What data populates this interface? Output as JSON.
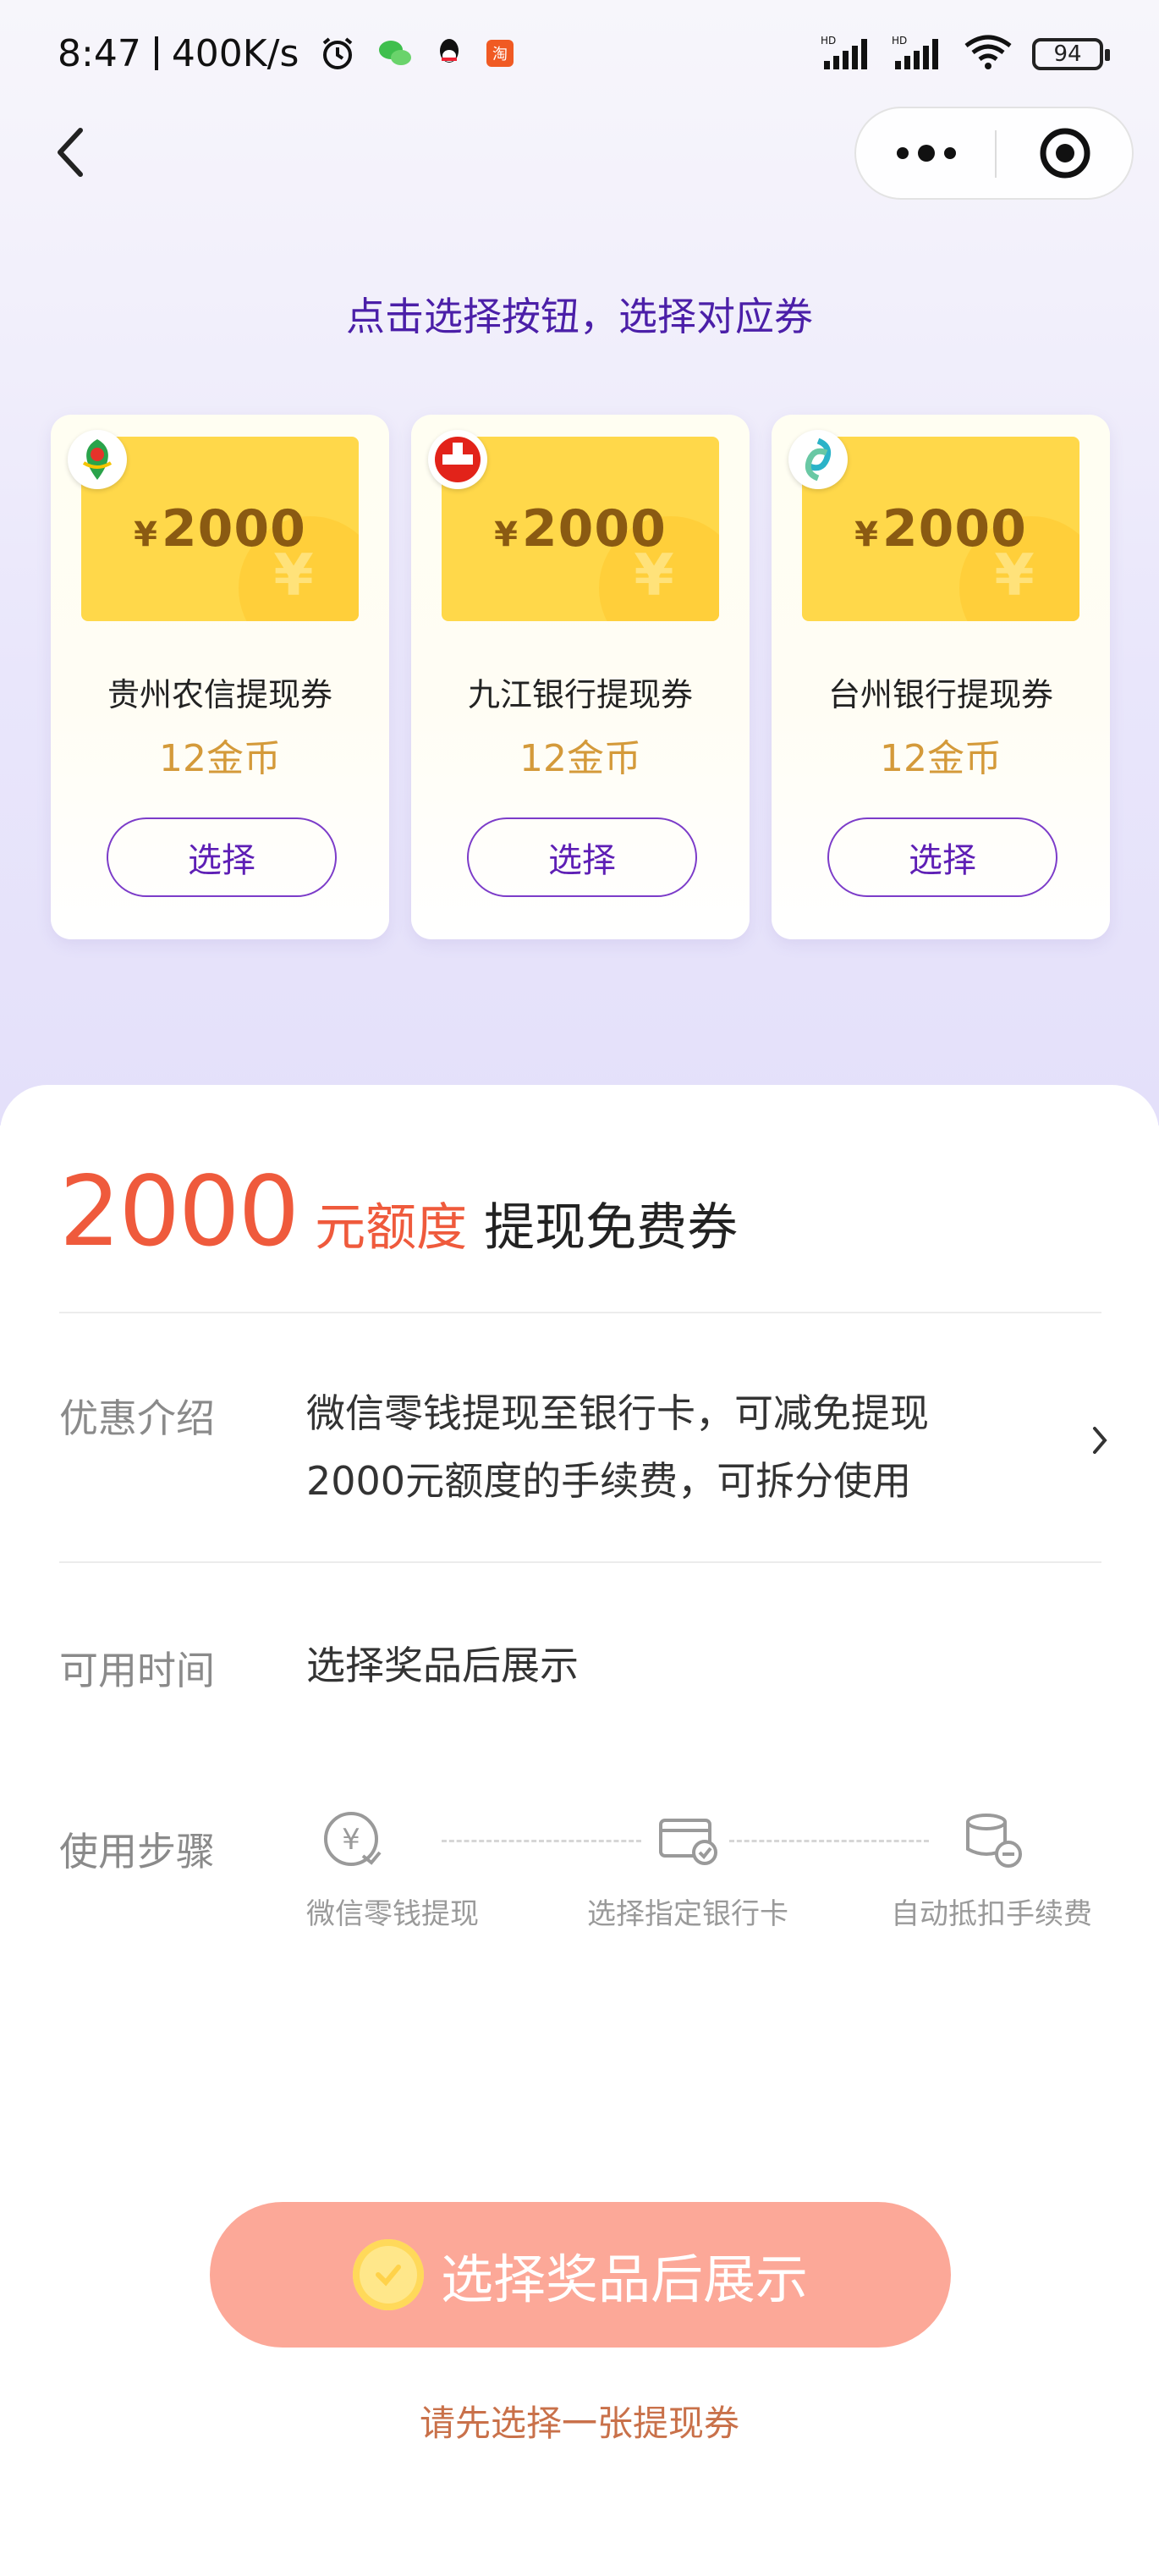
{
  "status_bar": {
    "time": "8:47",
    "speed": "400K/s",
    "battery": "94"
  },
  "hint": "点击选择按钮，选择对应券",
  "coupons": [
    {
      "amount": "2000",
      "currency": "¥",
      "name": "贵州农信提现券",
      "price": "12金币",
      "button": "选择",
      "logo": "gzrcc-logo"
    },
    {
      "amount": "2000",
      "currency": "¥",
      "name": "九江银行提现券",
      "price": "12金币",
      "button": "选择",
      "logo": "jjbank-logo"
    },
    {
      "amount": "2000",
      "currency": "¥",
      "name": "台州银行提现券",
      "price": "12金币",
      "button": "选择",
      "logo": "tzbank-logo"
    }
  ],
  "detail": {
    "amount": "2000",
    "unit": "元额度",
    "label": "提现免费券",
    "intro_label": "优惠介绍",
    "intro_line1": "微信零钱提现至银行卡，可减免提现",
    "intro_line2": "2000元额度的手续费，可拆分使用",
    "time_label": "可用时间",
    "time_value": "选择奖品后展示",
    "steps_label": "使用步骤",
    "steps": [
      "微信零钱提现",
      "选择指定银行卡",
      "自动抵扣手续费"
    ]
  },
  "cta": {
    "label": "选择奖品后展示",
    "sub_hint": "请先选择一张提现券"
  },
  "colors": {
    "accent_purple": "#5e1fb5",
    "amount_red": "#ef5a3c",
    "cta_bg": "#fca898",
    "coupon_yellow": "#ffd84a"
  }
}
